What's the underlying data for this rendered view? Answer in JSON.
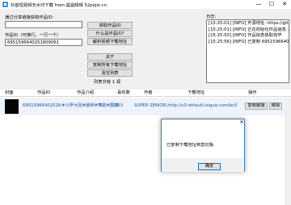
{
  "window": {
    "title": "抖音短视频无水印下载 from 晨晨晴晴 52pojie.cn",
    "minimize": "—",
    "maximize": "☐",
    "close": "✕"
  },
  "form": {
    "share_label": "通过分享链接获取作品ID:",
    "share_value": "",
    "works_label": "作品ID（可换行，一行一个）",
    "works_value": "6951596640251809061"
  },
  "buttons": {
    "get_id": "获取作品ID",
    "what_is_id": "什么是作品ID?",
    "parse_urls": "解析视频下载地址",
    "about": "关于",
    "copy_all": "复制所有下载地址",
    "clear_list": "清空列表"
  },
  "list_count": "列表共有 1 视",
  "log": {
    "label": "日志:",
    "lines": [
      "[15:25:01] [INFO] 开源地址: https://github.com/MrXiaoM/DouYinVideo",
      "[15:25:01] [INFO] 正在初始化作品信息...",
      "[15:25:50] [INFO] 作品信息获取完毕",
      "[15:25:56] [INFO] 已复制 6951596640251809061 的下载地址"
    ]
  },
  "table": {
    "headers": [
      "封面",
      "作品ID",
      "作品介绍",
      "喜欢数",
      "作者",
      "下载地址",
      "操作"
    ],
    "row": {
      "id": "69515966402518",
      "desc": "#斗罗大陆#破碎#舞蹈#翻跳",
      "likes": "253",
      "author": "SUPER SENIOR|",
      "url": "http://v3-default.ixigua.com/bc0",
      "copy_btn": "复制链接",
      "delete_btn": "移除"
    }
  },
  "dialog": {
    "close": "✕",
    "message": "已复制下载地址到剪切板",
    "ok": "确定"
  },
  "colors": {
    "accent": "#0078d7",
    "link": "#1f4f9e",
    "row_bg": "#eef3fb"
  }
}
